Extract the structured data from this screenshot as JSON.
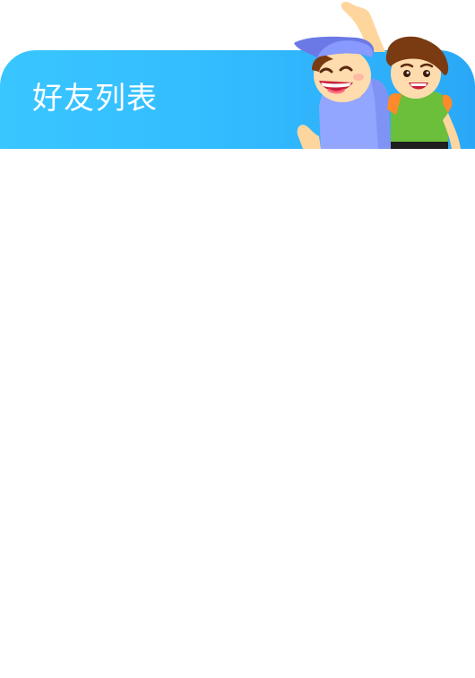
{
  "header": {
    "title": "好友列表"
  },
  "illustration": {
    "description_icon": "two-cheering-kids-illustration"
  },
  "colors": {
    "header_gradient_start": "#39c6ff",
    "header_gradient_end": "#2aa8f7",
    "title_text": "#ffffff",
    "background": "#ffffff"
  }
}
